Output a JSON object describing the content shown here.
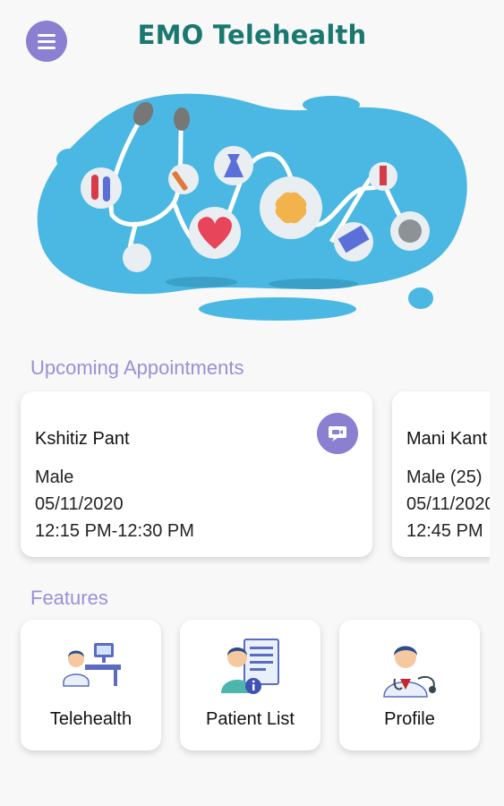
{
  "header": {
    "title": "EMO Telehealth",
    "menu_icon": "hamburger-menu-icon"
  },
  "colors": {
    "accent": "#8a7fd0",
    "title": "#19786f",
    "section": "#9b8fd6",
    "hero_blob": "#4ab8e2"
  },
  "sections": {
    "upcoming_title": "Upcoming Appointments",
    "features_title": "Features"
  },
  "appointments": [
    {
      "name": "Kshitiz Pant",
      "gender": "Male",
      "date": "05/11/2020",
      "time": "12:15 PM-12:30 PM",
      "action_icon": "video-call-icon"
    },
    {
      "name": "Mani Kant",
      "gender": "Male (25)",
      "date": "05/11/2020",
      "time": "12:45 PM"
    }
  ],
  "features": [
    {
      "label": "Telehealth",
      "icon": "doctor-desk-icon"
    },
    {
      "label": "Patient List",
      "icon": "patient-list-icon"
    },
    {
      "label": "Profile",
      "icon": "doctor-profile-icon"
    }
  ]
}
